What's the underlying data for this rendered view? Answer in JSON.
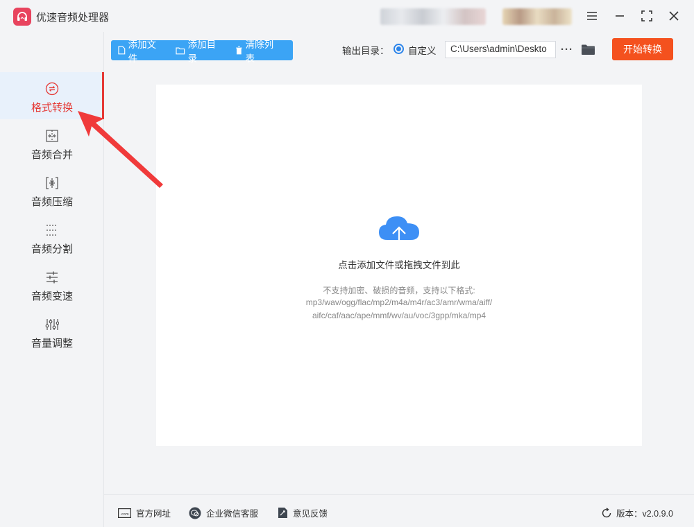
{
  "app": {
    "title": "优速音频处理器"
  },
  "sidebar": {
    "items": [
      {
        "label": "格式转换",
        "icon": "swap-circle-icon",
        "active": true
      },
      {
        "label": "音频合并",
        "icon": "merge-icon"
      },
      {
        "label": "音频压缩",
        "icon": "compress-icon"
      },
      {
        "label": "音频分割",
        "icon": "split-icon"
      },
      {
        "label": "音频变速",
        "icon": "speed-icon"
      },
      {
        "label": "音量调整",
        "icon": "volume-sliders-icon"
      }
    ]
  },
  "toolbar": {
    "add_file": "添加文件",
    "add_dir": "添加目录",
    "clear_list": "清除列表",
    "output_label": "输出目录：",
    "custom_label": "自定义",
    "output_path": "C:\\Users\\admin\\Deskto",
    "more": "···",
    "start": "开始转换"
  },
  "dropzone": {
    "title": "点击添加文件或拖拽文件到此",
    "hint1": "不支持加密、破损的音频，支持以下格式:",
    "hint2": "mp3/wav/ogg/flac/mp2/m4a/m4r/ac3/amr/wma/aiff/",
    "hint3": "aifc/caf/aac/ape/mmf/wv/au/voc/3gpp/mka/mp4"
  },
  "footer": {
    "website": "官方网址",
    "wechat": "企业微信客服",
    "feedback": "意见反馈",
    "version": "版本：v2.0.9.0"
  },
  "colors": {
    "accent_blue": "#3ba4f5",
    "start_orange": "#f4511e",
    "active_red": "#e53935",
    "logo_pink": "#e8445e"
  }
}
